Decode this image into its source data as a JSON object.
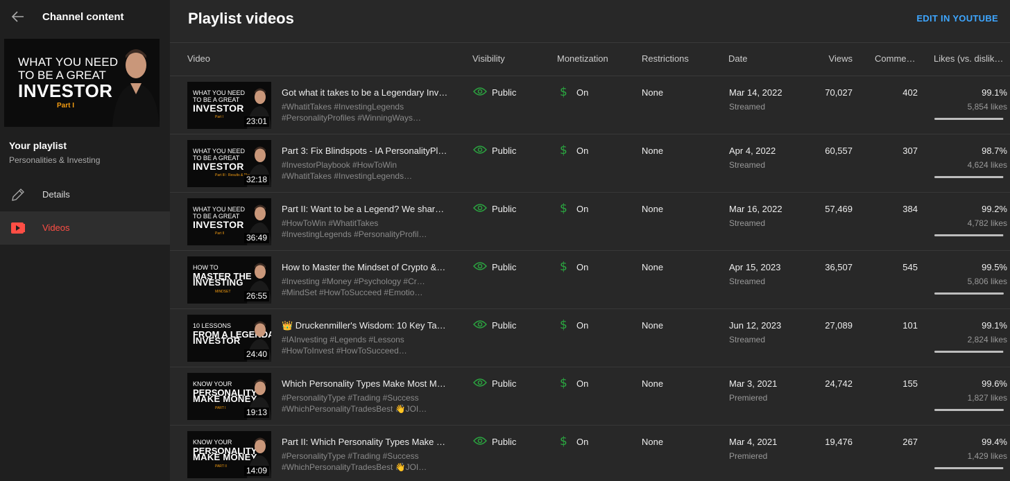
{
  "sidebar": {
    "header_title": "Channel content",
    "thumbnail": {
      "line1": "WHAT YOU NEED",
      "line2": "TO BE A GREAT",
      "line3": "INVESTOR",
      "line4": "Part I"
    },
    "playlist_label": "Your playlist",
    "playlist_name": "Personalities & Investing",
    "nav": [
      {
        "label": "Details",
        "icon": "pencil-icon",
        "active": false
      },
      {
        "label": "Videos",
        "icon": "video-icon",
        "active": true
      }
    ]
  },
  "main": {
    "title": "Playlist videos",
    "edit_link": "EDIT IN YOUTUBE",
    "columns": {
      "video": "Video",
      "visibility": "Visibility",
      "monetization": "Monetization",
      "restrictions": "Restrictions",
      "date": "Date",
      "views": "Views",
      "comments": "Comme…",
      "likes": "Likes (vs. dislik…"
    },
    "rows": [
      {
        "thumb": {
          "a": "WHAT YOU NEED",
          "b": "TO BE A GREAT",
          "c": "INVESTOR",
          "d": "Part I"
        },
        "duration": "23:01",
        "title": "Got what it takes to be a Legendary Inv…",
        "desc1": "#WhatitTakes #InvestingLegends",
        "desc2": "#PersonalityProfiles #WinningWays…",
        "visibility": "Public",
        "monetization": "On",
        "restrictions": "None",
        "date": "Mar 14, 2022",
        "date_type": "Streamed",
        "views": "70,027",
        "comments": "402",
        "likes_pct": "99.1%",
        "likes_count": "5,854 likes",
        "likes_ratio": 0.991
      },
      {
        "thumb": {
          "a": "WHAT YOU NEED",
          "b": "TO BE A GREAT",
          "c": "INVESTOR",
          "d": "Part III : Results & Playb"
        },
        "duration": "32:18",
        "title": "Part 3: Fix Blindspots - IA PersonalityPl…",
        "desc1": "#InvestorPlaybook #HowToWin",
        "desc2": "#WhatitTakes #InvestingLegends…",
        "visibility": "Public",
        "monetization": "On",
        "restrictions": "None",
        "date": "Apr 4, 2022",
        "date_type": "Streamed",
        "views": "60,557",
        "comments": "307",
        "likes_pct": "98.7%",
        "likes_count": "4,624 likes",
        "likes_ratio": 0.987
      },
      {
        "thumb": {
          "a": "WHAT YOU NEED",
          "b": "TO BE A GREAT",
          "c": "INVESTOR",
          "d": "Part II"
        },
        "duration": "36:49",
        "title": "Part II: Want to be a Legend? We share …",
        "desc1": "#HowToWin #WhatitTakes",
        "desc2": "#InvestingLegends #PersonalityProfiles…",
        "visibility": "Public",
        "monetization": "On",
        "restrictions": "None",
        "date": "Mar 16, 2022",
        "date_type": "Streamed",
        "views": "57,469",
        "comments": "384",
        "likes_pct": "99.2%",
        "likes_count": "4,782 likes",
        "likes_ratio": 0.992
      },
      {
        "thumb": {
          "a": "HOW TO",
          "b": "MASTER THE",
          "c": "INVESTING",
          "d": "MINDSET"
        },
        "duration": "26:55",
        "title": "How to Master the Mindset of Crypto &…",
        "desc1": "#Investing #Money #Psychology #Crypto",
        "desc2": "#MindSet #HowToSucceed #Emotions…",
        "visibility": "Public",
        "monetization": "On",
        "restrictions": "None",
        "date": "Apr 15, 2023",
        "date_type": "Streamed",
        "views": "36,507",
        "comments": "545",
        "likes_pct": "99.5%",
        "likes_count": "5,806 likes",
        "likes_ratio": 0.995
      },
      {
        "thumb": {
          "a": "10 LESSONS",
          "b": "FROM A LEGENDARY",
          "c": "INVESTOR",
          "d": ""
        },
        "duration": "24:40",
        "title": "👑 Druckenmiller's Wisdom: 10 Key Tak…",
        "desc1": "#IAInvesting #Legends #Lessons",
        "desc2": "#HowToInvest #HowToSucceed…",
        "visibility": "Public",
        "monetization": "On",
        "restrictions": "None",
        "date": "Jun 12, 2023",
        "date_type": "Streamed",
        "views": "27,089",
        "comments": "101",
        "likes_pct": "99.1%",
        "likes_count": "2,824 likes",
        "likes_ratio": 0.991
      },
      {
        "thumb": {
          "a": "KNOW YOUR",
          "b": "PERSONALITY",
          "c": "MAKE MONEY",
          "d": "PART I"
        },
        "duration": "19:13",
        "title": "Which Personality Types Make Most M…",
        "desc1": "#PersonalityType #Trading #Success",
        "desc2": "#WhichPersonalityTradesBest 👋JOIN T…",
        "visibility": "Public",
        "monetization": "On",
        "restrictions": "None",
        "date": "Mar 3, 2021",
        "date_type": "Premiered",
        "views": "24,742",
        "comments": "155",
        "likes_pct": "99.6%",
        "likes_count": "1,827 likes",
        "likes_ratio": 0.996
      },
      {
        "thumb": {
          "a": "KNOW YOUR",
          "b": "PERSONALITY",
          "c": "MAKE MONEY",
          "d": "PART II"
        },
        "duration": "14:09",
        "title": "Part II: Which Personality Types Make …",
        "desc1": "#PersonalityType #Trading #Success",
        "desc2": "#WhichPersonalityTradesBest 👋JOIN T…",
        "visibility": "Public",
        "monetization": "On",
        "restrictions": "None",
        "date": "Mar 4, 2021",
        "date_type": "Premiered",
        "views": "19,476",
        "comments": "267",
        "likes_pct": "99.4%",
        "likes_count": "1,429 likes",
        "likes_ratio": 0.994
      }
    ]
  },
  "colors": {
    "accent_link": "#3ea6ff",
    "active_nav": "#ff4e45",
    "monetization_green": "#2ba640",
    "visibility_green": "#2ba640"
  }
}
